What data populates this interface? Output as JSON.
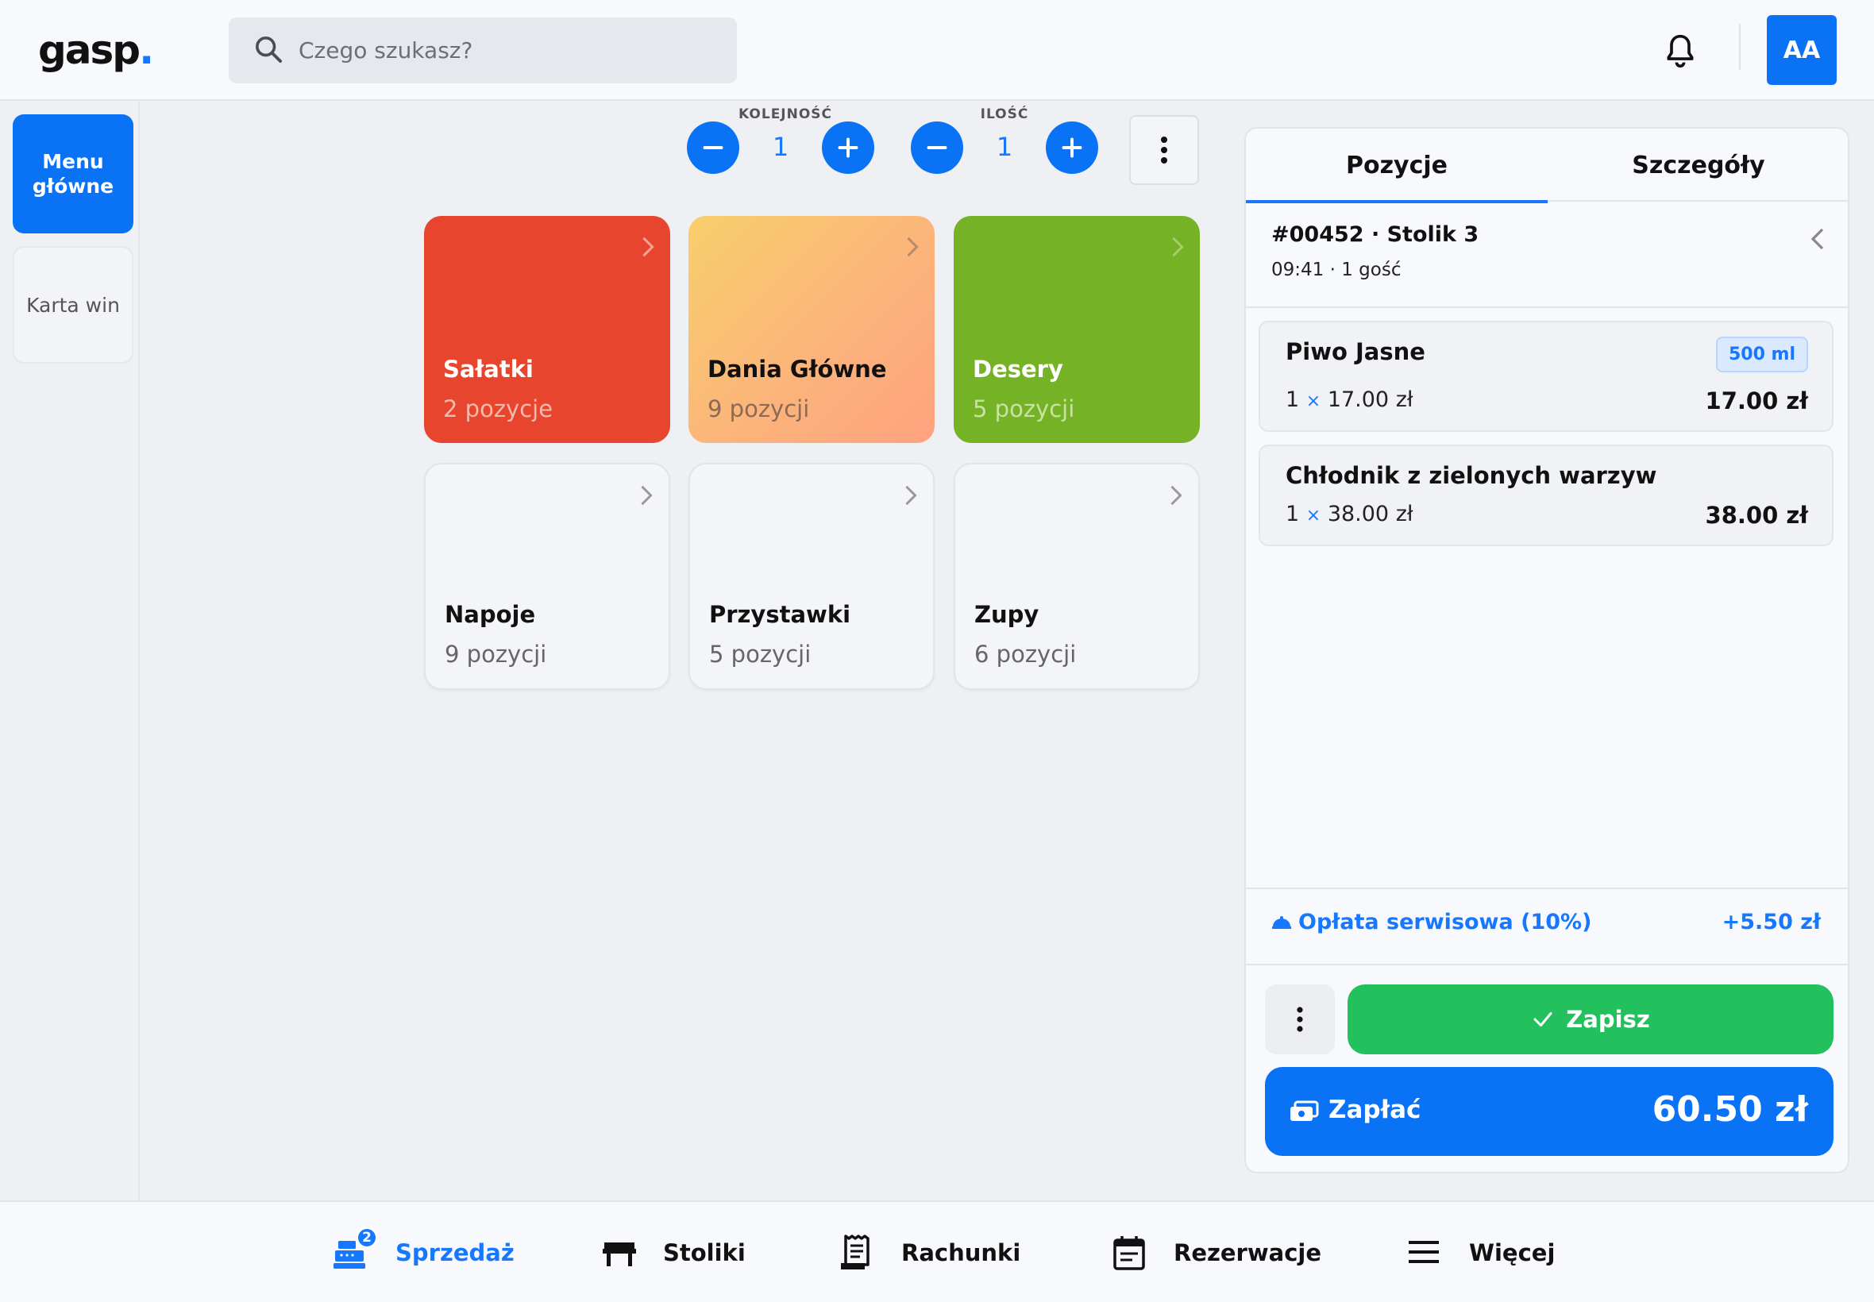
{
  "header": {
    "logo": "gasp",
    "logo_dot": ".",
    "search_placeholder": "Czego szukasz?",
    "avatar_initials": "AA"
  },
  "sidebar": {
    "items": [
      {
        "label": "Menu główne",
        "active": true
      },
      {
        "label": "Karta win",
        "active": false
      }
    ]
  },
  "controls": {
    "order_label": "KOLEJNOŚĆ",
    "order_value": "1",
    "quantity_label": "ILOŚĆ",
    "quantity_value": "1"
  },
  "categories": [
    {
      "name": "Sałatki",
      "count": "2 pozycje",
      "color": "#e8452e"
    },
    {
      "name": "Dania Główne",
      "count": "9 pozycji",
      "color": "#fcb27b"
    },
    {
      "name": "Desery",
      "count": "5 pozycji",
      "color": "#76b226"
    },
    {
      "name": "Napoje",
      "count": "9 pozycji",
      "color": "#f4f5f8"
    },
    {
      "name": "Przystawki",
      "count": "5 pozycji",
      "color": "#f4f5f8"
    },
    {
      "name": "Zupy",
      "count": "6 pozycji",
      "color": "#f4f5f8"
    }
  ],
  "order": {
    "tabs": [
      "Pozycje",
      "Szczegóły"
    ],
    "active_tab": "Pozycje",
    "title": "#00452 · Stolik 3",
    "subtitle": "09:41 · 1 gość",
    "items": [
      {
        "name": "Piwo Jasne",
        "badge": "500 ml",
        "qty": "1",
        "unit_price": "17.00 zł",
        "total": "17.00 zł"
      },
      {
        "name": "Chłodnik z zielonych warzyw",
        "qty": "1",
        "unit_price": "38.00 zł",
        "total": "38.00 zł"
      }
    ],
    "times_symbol": "×",
    "service_fee_label": "Opłata serwisowa (10%)",
    "service_fee_amount": "+5.50 zł",
    "save_label": "Zapisz",
    "pay_label": "Zapłać",
    "pay_amount": "60.50 zł"
  },
  "bottom_nav": {
    "items": [
      {
        "label": "Sprzedaż",
        "icon": "cash-register-icon",
        "badge": "2",
        "active": true
      },
      {
        "label": "Stoliki",
        "icon": "table-icon"
      },
      {
        "label": "Rachunki",
        "icon": "receipt-icon"
      },
      {
        "label": "Rezerwacje",
        "icon": "calendar-icon"
      },
      {
        "label": "Więcej",
        "icon": "menu-icon"
      }
    ]
  },
  "colors": {
    "accent": "#0a73f5",
    "success": "#22c15e"
  }
}
